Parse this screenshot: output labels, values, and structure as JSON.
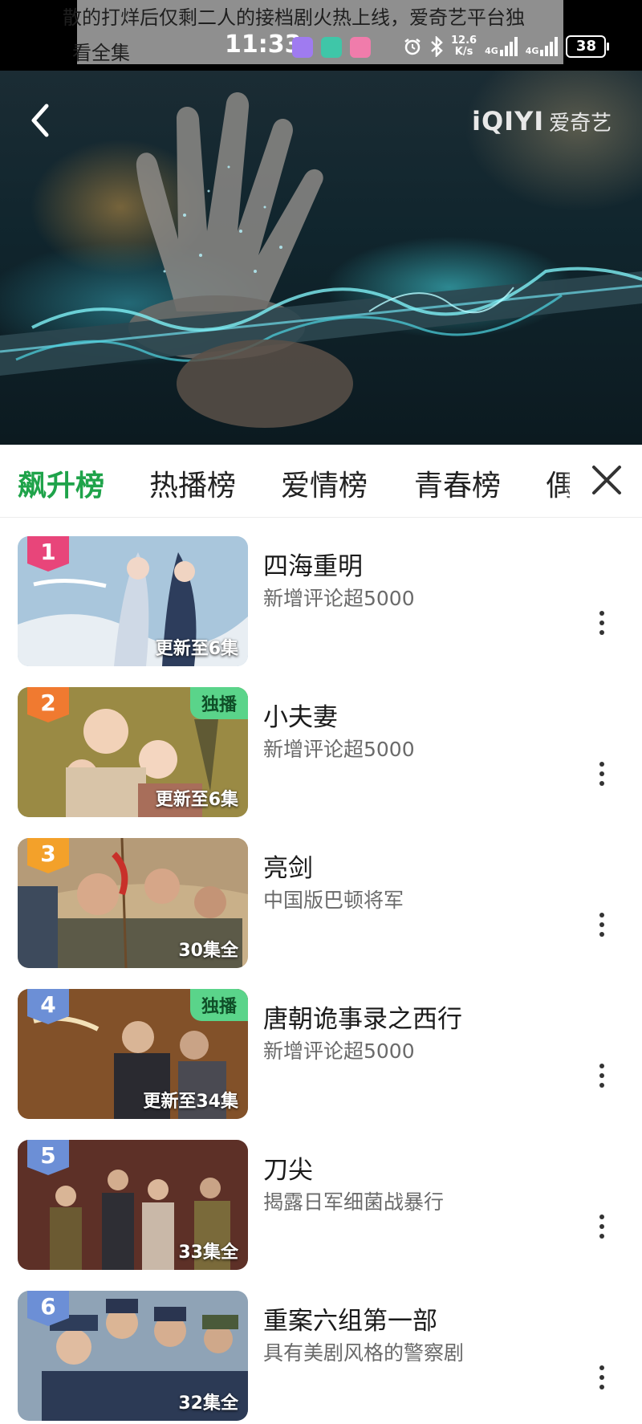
{
  "status_bar": {
    "notification_line1": "散的打烊后仅剩二人的接档剧火热上线，爱奇艺平台独",
    "notification_line2": "看全集",
    "time": "11:33",
    "speed_value": "12.6",
    "speed_unit": "K/s",
    "network1": "4G",
    "network2": "4G",
    "battery": "38"
  },
  "player": {
    "logo_en": "iQIYI",
    "logo_zh": "爱奇艺",
    "glow_color": "#46dce6"
  },
  "tabs": {
    "items": [
      "飙升榜",
      "热播榜",
      "爱情榜",
      "青春榜"
    ],
    "partial": "偶",
    "active_index": 0,
    "active_color": "#1fa34a"
  },
  "ranking": [
    {
      "rank": "1",
      "title": "四海重明",
      "desc": "新增评论超5000",
      "episodes": "更新至6集",
      "badge": "",
      "rank_color": "#e8457a"
    },
    {
      "rank": "2",
      "title": "小夫妻",
      "desc": "新增评论超5000",
      "episodes": "更新至6集",
      "badge": "独播",
      "rank_color": "#f07a30"
    },
    {
      "rank": "3",
      "title": "亮剑",
      "desc": "中国版巴顿将军",
      "episodes": "30集全",
      "badge": "",
      "rank_color": "#f3a12a"
    },
    {
      "rank": "4",
      "title": "唐朝诡事录之西行",
      "desc": "新增评论超5000",
      "episodes": "更新至34集",
      "badge": "独播",
      "rank_color": "#6c8fd6"
    },
    {
      "rank": "5",
      "title": "刀尖",
      "desc": "揭露日军细菌战暴行",
      "episodes": "33集全",
      "badge": "",
      "rank_color": "#6c8fd6"
    },
    {
      "rank": "6",
      "title": "重案六组第一部",
      "desc": "具有美剧风格的警察剧",
      "episodes": "32集全",
      "badge": "",
      "rank_color": "#6c8fd6"
    }
  ]
}
